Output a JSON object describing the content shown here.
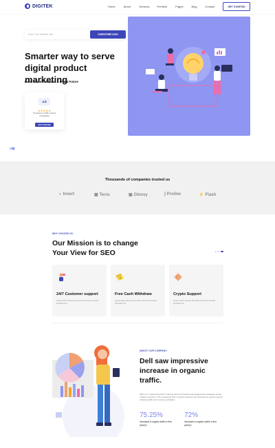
{
  "brand": {
    "name": "DIGITEK",
    "accent": "#3d46b8",
    "hero_bg": "#8e96f2"
  },
  "nav": {
    "items": [
      "Home",
      "About",
      "Services",
      "Portfolio",
      "Pages",
      "Blog",
      "Contact"
    ],
    "cta": "GET STARTED"
  },
  "hero": {
    "email_placeholder": "Enter Your Website Link",
    "subscribe_label": "SUBSCRIBE NOW",
    "title": "Smarter way to serve digital product marketing",
    "subtitle": "Build Your Innovations & Digital Future",
    "rating": {
      "score": "4.8",
      "stars": "★★★★★",
      "trusted_text": "Trusted by 1,000+ Invent companies",
      "button": "GET STARTED"
    }
  },
  "trusted": {
    "title": "Thousands of companies trusted us",
    "brands": [
      {
        "name": "Invert",
        "icon": "circle-logo-icon",
        "glyph": "◐"
      },
      {
        "name": "Terra",
        "icon": "terra-logo-icon",
        "glyph": "▦"
      },
      {
        "name": "Glossy",
        "icon": "glossy-logo-icon",
        "glyph": "▣"
      },
      {
        "name": "Proline",
        "icon": "proline-logo-icon",
        "glyph": "∫"
      },
      {
        "name": "Flash",
        "icon": "flash-logo-icon",
        "glyph": "⚡"
      }
    ]
  },
  "mission": {
    "label": "WHY CHOOSE US",
    "title": "Our Mission is to change Your View for SEO",
    "cards": [
      {
        "title": "24/7 Customer support",
        "desc": "Lorem ipsum dummy text dolor text amet console provides text",
        "icon": "support-person-icon"
      },
      {
        "title": "Free Cash Withdraw",
        "desc": "Lorem ipsum dummy text dolor text amet console provides text",
        "icon": "cash-stack-icon"
      },
      {
        "title": "Crypto Support",
        "desc": "Lorem ipsum dummy text dolor text amet console provides text",
        "icon": "crypto-coin-icon"
      }
    ]
  },
  "about": {
    "label": "ABOUT OUR COMPANY",
    "title": "Dell saw impressive increase in organic traffic.",
    "desc": "SEO.com worked with Dell 's internal team and implemented aggressive strategies across multiple countries. This recognized Dell 's search presence and increase its organic search rankings traffic and revenue worldwide.",
    "stats": [
      {
        "value": "75.25%",
        "label": "Increased in organic traffic in first year(s)~"
      },
      {
        "value": "72%",
        "label": "Increased in organic traffic in first year(s)~"
      }
    ]
  }
}
